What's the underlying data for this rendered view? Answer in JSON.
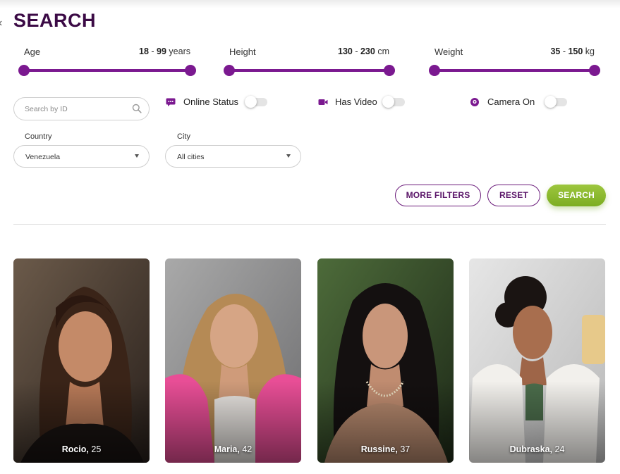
{
  "page": {
    "title": "SEARCH",
    "back_glyph": "‹"
  },
  "ranges": [
    {
      "label": "Age",
      "min": "18",
      "max": "99",
      "unit": "years"
    },
    {
      "label": "Height",
      "min": "130",
      "max": "230",
      "unit": "cm"
    },
    {
      "label": "Weight",
      "min": "35",
      "max": "150",
      "unit": "kg"
    }
  ],
  "search": {
    "placeholder": "Search by ID",
    "icon": "magnifier-icon"
  },
  "toggles": [
    {
      "label": "Online Status",
      "icon": "chat-bubble-icon",
      "on": false
    },
    {
      "label": "Has Video",
      "icon": "video-camera-icon",
      "on": false
    },
    {
      "label": "Camera On",
      "icon": "webcam-icon",
      "on": false
    }
  ],
  "filters": {
    "country": {
      "label": "Country",
      "value": "Venezuela"
    },
    "city": {
      "label": "City",
      "value": "All cities"
    }
  },
  "buttons": {
    "more_filters": "MORE FILTERS",
    "reset": "RESET",
    "search": "SEARCH"
  },
  "profiles": [
    {
      "name": "Rocio",
      "age": "25"
    },
    {
      "name": "Maria",
      "age": "42"
    },
    {
      "name": "Russine",
      "age": "37"
    },
    {
      "name": "Dubraska",
      "age": "24"
    }
  ],
  "colors": {
    "accent": "#7b1990",
    "title": "#3b0a45",
    "search_button": "#8dbb2f"
  }
}
